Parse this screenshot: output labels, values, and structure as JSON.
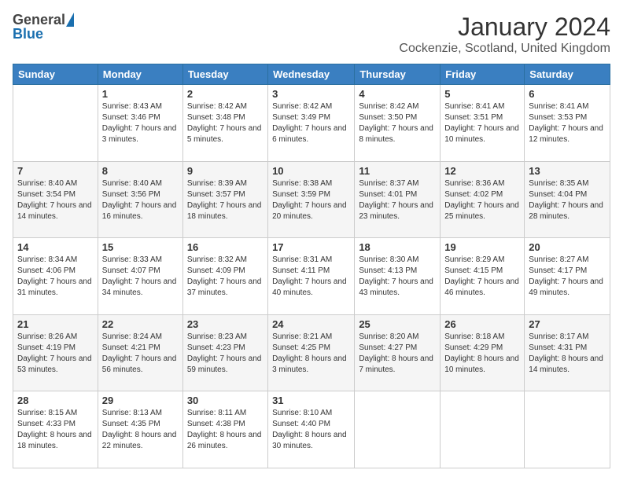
{
  "header": {
    "logo_general": "General",
    "logo_blue": "Blue",
    "month_title": "January 2024",
    "location": "Cockenzie, Scotland, United Kingdom"
  },
  "weekdays": [
    "Sunday",
    "Monday",
    "Tuesday",
    "Wednesday",
    "Thursday",
    "Friday",
    "Saturday"
  ],
  "weeks": [
    [
      {
        "day": "",
        "sunrise": "",
        "sunset": "",
        "daylight": ""
      },
      {
        "day": "1",
        "sunrise": "Sunrise: 8:43 AM",
        "sunset": "Sunset: 3:46 PM",
        "daylight": "Daylight: 7 hours and 3 minutes."
      },
      {
        "day": "2",
        "sunrise": "Sunrise: 8:42 AM",
        "sunset": "Sunset: 3:48 PM",
        "daylight": "Daylight: 7 hours and 5 minutes."
      },
      {
        "day": "3",
        "sunrise": "Sunrise: 8:42 AM",
        "sunset": "Sunset: 3:49 PM",
        "daylight": "Daylight: 7 hours and 6 minutes."
      },
      {
        "day": "4",
        "sunrise": "Sunrise: 8:42 AM",
        "sunset": "Sunset: 3:50 PM",
        "daylight": "Daylight: 7 hours and 8 minutes."
      },
      {
        "day": "5",
        "sunrise": "Sunrise: 8:41 AM",
        "sunset": "Sunset: 3:51 PM",
        "daylight": "Daylight: 7 hours and 10 minutes."
      },
      {
        "day": "6",
        "sunrise": "Sunrise: 8:41 AM",
        "sunset": "Sunset: 3:53 PM",
        "daylight": "Daylight: 7 hours and 12 minutes."
      }
    ],
    [
      {
        "day": "7",
        "sunrise": "Sunrise: 8:40 AM",
        "sunset": "Sunset: 3:54 PM",
        "daylight": "Daylight: 7 hours and 14 minutes."
      },
      {
        "day": "8",
        "sunrise": "Sunrise: 8:40 AM",
        "sunset": "Sunset: 3:56 PM",
        "daylight": "Daylight: 7 hours and 16 minutes."
      },
      {
        "day": "9",
        "sunrise": "Sunrise: 8:39 AM",
        "sunset": "Sunset: 3:57 PM",
        "daylight": "Daylight: 7 hours and 18 minutes."
      },
      {
        "day": "10",
        "sunrise": "Sunrise: 8:38 AM",
        "sunset": "Sunset: 3:59 PM",
        "daylight": "Daylight: 7 hours and 20 minutes."
      },
      {
        "day": "11",
        "sunrise": "Sunrise: 8:37 AM",
        "sunset": "Sunset: 4:01 PM",
        "daylight": "Daylight: 7 hours and 23 minutes."
      },
      {
        "day": "12",
        "sunrise": "Sunrise: 8:36 AM",
        "sunset": "Sunset: 4:02 PM",
        "daylight": "Daylight: 7 hours and 25 minutes."
      },
      {
        "day": "13",
        "sunrise": "Sunrise: 8:35 AM",
        "sunset": "Sunset: 4:04 PM",
        "daylight": "Daylight: 7 hours and 28 minutes."
      }
    ],
    [
      {
        "day": "14",
        "sunrise": "Sunrise: 8:34 AM",
        "sunset": "Sunset: 4:06 PM",
        "daylight": "Daylight: 7 hours and 31 minutes."
      },
      {
        "day": "15",
        "sunrise": "Sunrise: 8:33 AM",
        "sunset": "Sunset: 4:07 PM",
        "daylight": "Daylight: 7 hours and 34 minutes."
      },
      {
        "day": "16",
        "sunrise": "Sunrise: 8:32 AM",
        "sunset": "Sunset: 4:09 PM",
        "daylight": "Daylight: 7 hours and 37 minutes."
      },
      {
        "day": "17",
        "sunrise": "Sunrise: 8:31 AM",
        "sunset": "Sunset: 4:11 PM",
        "daylight": "Daylight: 7 hours and 40 minutes."
      },
      {
        "day": "18",
        "sunrise": "Sunrise: 8:30 AM",
        "sunset": "Sunset: 4:13 PM",
        "daylight": "Daylight: 7 hours and 43 minutes."
      },
      {
        "day": "19",
        "sunrise": "Sunrise: 8:29 AM",
        "sunset": "Sunset: 4:15 PM",
        "daylight": "Daylight: 7 hours and 46 minutes."
      },
      {
        "day": "20",
        "sunrise": "Sunrise: 8:27 AM",
        "sunset": "Sunset: 4:17 PM",
        "daylight": "Daylight: 7 hours and 49 minutes."
      }
    ],
    [
      {
        "day": "21",
        "sunrise": "Sunrise: 8:26 AM",
        "sunset": "Sunset: 4:19 PM",
        "daylight": "Daylight: 7 hours and 53 minutes."
      },
      {
        "day": "22",
        "sunrise": "Sunrise: 8:24 AM",
        "sunset": "Sunset: 4:21 PM",
        "daylight": "Daylight: 7 hours and 56 minutes."
      },
      {
        "day": "23",
        "sunrise": "Sunrise: 8:23 AM",
        "sunset": "Sunset: 4:23 PM",
        "daylight": "Daylight: 7 hours and 59 minutes."
      },
      {
        "day": "24",
        "sunrise": "Sunrise: 8:21 AM",
        "sunset": "Sunset: 4:25 PM",
        "daylight": "Daylight: 8 hours and 3 minutes."
      },
      {
        "day": "25",
        "sunrise": "Sunrise: 8:20 AM",
        "sunset": "Sunset: 4:27 PM",
        "daylight": "Daylight: 8 hours and 7 minutes."
      },
      {
        "day": "26",
        "sunrise": "Sunrise: 8:18 AM",
        "sunset": "Sunset: 4:29 PM",
        "daylight": "Daylight: 8 hours and 10 minutes."
      },
      {
        "day": "27",
        "sunrise": "Sunrise: 8:17 AM",
        "sunset": "Sunset: 4:31 PM",
        "daylight": "Daylight: 8 hours and 14 minutes."
      }
    ],
    [
      {
        "day": "28",
        "sunrise": "Sunrise: 8:15 AM",
        "sunset": "Sunset: 4:33 PM",
        "daylight": "Daylight: 8 hours and 18 minutes."
      },
      {
        "day": "29",
        "sunrise": "Sunrise: 8:13 AM",
        "sunset": "Sunset: 4:35 PM",
        "daylight": "Daylight: 8 hours and 22 minutes."
      },
      {
        "day": "30",
        "sunrise": "Sunrise: 8:11 AM",
        "sunset": "Sunset: 4:38 PM",
        "daylight": "Daylight: 8 hours and 26 minutes."
      },
      {
        "day": "31",
        "sunrise": "Sunrise: 8:10 AM",
        "sunset": "Sunset: 4:40 PM",
        "daylight": "Daylight: 8 hours and 30 minutes."
      },
      {
        "day": "",
        "sunrise": "",
        "sunset": "",
        "daylight": ""
      },
      {
        "day": "",
        "sunrise": "",
        "sunset": "",
        "daylight": ""
      },
      {
        "day": "",
        "sunrise": "",
        "sunset": "",
        "daylight": ""
      }
    ]
  ]
}
